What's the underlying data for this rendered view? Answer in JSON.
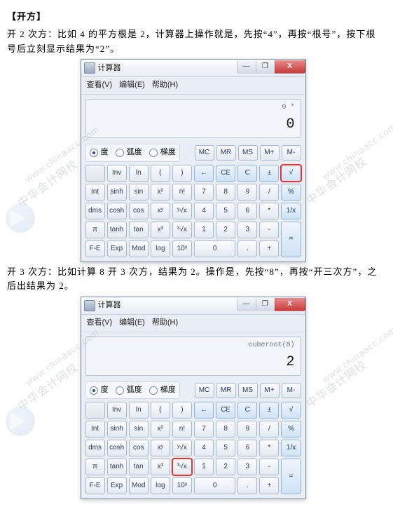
{
  "text": {
    "heading": "【开方】",
    "para1": "开 2 次方：比如 4 的平方根是 2，计算器上操作就是，先按“4”，再按“根号”，按下根号后立刻显示结果为“2”。",
    "para2": "开 3 次方：比如计算 8 开 3 次方，结果为 2。操作是，先按“8”，再按“开三次方”，之后出结果为 2。"
  },
  "watermark": {
    "cn": "中华会计网校",
    "url": "www.chinaacc.com"
  },
  "window": {
    "title": "计算器",
    "menu": {
      "view": "查看(V)",
      "edit": "编辑(E)",
      "help": "帮助(H)"
    },
    "win_btns": {
      "min": "—",
      "max": "❐",
      "close": "X"
    }
  },
  "angle": {
    "deg": "度",
    "rad": "弧度",
    "grad": "梯度"
  },
  "memory": {
    "mc": "MC",
    "mr": "MR",
    "ms": "MS",
    "mplus": "M+",
    "mminus": "M-"
  },
  "buttons": {
    "r1": {
      "empty": "",
      "inv": "Inv",
      "ln": "ln",
      "lp": "(",
      "rp": ")",
      "bksp": "←",
      "ce": "CE",
      "c": "C",
      "pm": "±",
      "sqrt": "√"
    },
    "r2": {
      "int": "Int",
      "sinh": "sinh",
      "sin": "sin",
      "x2": "x²",
      "nfac": "n!",
      "d7": "7",
      "d8": "8",
      "d9": "9",
      "div": "/",
      "pct": "%"
    },
    "r3": {
      "dms": "dms",
      "cosh": "cosh",
      "cos": "cos",
      "xy": "xʸ",
      "yroot": "ʸ√x",
      "d4": "4",
      "d5": "5",
      "d6": "6",
      "mul": "*",
      "inv1x": "1/x"
    },
    "r4": {
      "pi": "π",
      "tanh": "tanh",
      "tan": "tan",
      "x3": "x³",
      "cbrt": "³√x",
      "d1": "1",
      "d2": "2",
      "d3": "3",
      "minus": "-",
      "eq": "="
    },
    "r5": {
      "fe": "F-E",
      "exp": "Exp",
      "mod": "Mod",
      "log": "log",
      "tenx": "10ˣ",
      "d0": "0",
      "dot": ".",
      "plus": "+"
    }
  },
  "calc1": {
    "history": "0 *",
    "result": "0",
    "highlight": "sqrt"
  },
  "calc2": {
    "history": "cuberoot(8)",
    "result": "2",
    "highlight": "cbrt"
  }
}
